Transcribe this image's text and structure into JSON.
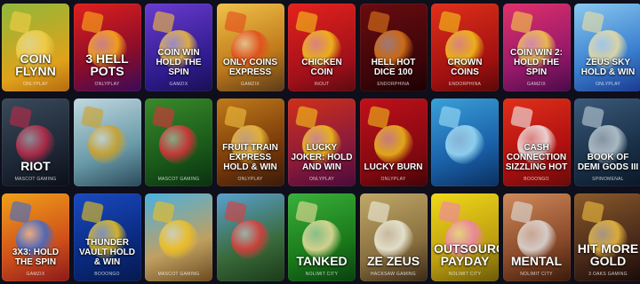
{
  "games": [
    {
      "title": "COIN FLYNN",
      "provider": "ONLYPLAY",
      "bg": "linear-gradient(160deg,#8fb83a,#e0a21a 70%,#b36a12)",
      "accent": "#f5d04a",
      "big": true
    },
    {
      "title": "3 HELL POTS",
      "provider": "ONLYPLAY",
      "bg": "linear-gradient(160deg,#e0201c,#8a0d2a 60%,#3a0a5a)",
      "accent": "#ffb31a",
      "big": true
    },
    {
      "title": "COIN WIN HOLD THE SPIN",
      "provider": "GAMZIX",
      "bg": "linear-gradient(160deg,#6a3bd0,#2d1a8a 70%,#1a1050)",
      "accent": "#f6c23a",
      "big": false
    },
    {
      "title": "ONLY COINS EXPRESS",
      "provider": "GAMZIX",
      "bg": "linear-gradient(160deg,#f0c24a,#c07a1a 60%,#5a3a1a)",
      "accent": "#e44a1a",
      "big": false
    },
    {
      "title": "CHICKEN COIN",
      "provider": "INOUT",
      "bg": "linear-gradient(160deg,#e5221c,#a0101a 70%,#5a0a10)",
      "accent": "#f5c81a",
      "big": false
    },
    {
      "title": "HELL HOT DICE 100",
      "provider": "ENDORPHINA",
      "bg": "linear-gradient(160deg,#6a0c10,#3a0508 70%,#1a0204)",
      "accent": "#e07a1a",
      "big": false
    },
    {
      "title": "CROWN COINS",
      "provider": "ENDORPHINA",
      "bg": "linear-gradient(160deg,#e0301a,#a01010 70%,#5a0808)",
      "accent": "#f6c81a",
      "big": false
    },
    {
      "title": "COIN WIN 2: HOLD THE SPIN",
      "provider": "GAMZIX",
      "bg": "linear-gradient(160deg,#e0306a,#9a1a6a 60%,#4a0a4a)",
      "accent": "#f5d04a",
      "big": false
    },
    {
      "title": "ZEUS SKY HOLD & WIN",
      "provider": "ONLYPLAY",
      "bg": "linear-gradient(160deg,#8ac8f0,#3a80d0 60%,#1a3a90)",
      "accent": "#f0e0a0",
      "big": false
    },
    {
      "title": "RIOT",
      "provider": "MASCOT GAMING",
      "bg": "linear-gradient(160deg,#3a4a5a,#1a2230 70%,#0a1018)",
      "accent": "#c02a4a",
      "big": true
    },
    {
      "title": "",
      "provider": "",
      "bg": "linear-gradient(160deg,#c0d8e0,#6a9aa8 60%,#2a4a5a)",
      "accent": "#d0a020",
      "big": false
    },
    {
      "title": "",
      "provider": "MASCOT GAMING",
      "bg": "linear-gradient(160deg,#3a8a2a,#1a5a1a 60%,#0a3010)",
      "accent": "#e0303a",
      "big": false
    },
    {
      "title": "FRUIT TRAIN EXPRESS HOLD & WIN",
      "provider": "ONLYPLAY",
      "bg": "linear-gradient(160deg,#c07a1a,#7a3a0a 60%,#3a1a0a)",
      "accent": "#f0c040",
      "big": false
    },
    {
      "title": "LUCKY JOKER: HOLD AND WIN",
      "provider": "ONLYPLAY",
      "bg": "linear-gradient(160deg,#d0301a,#8a1a3a 60%,#4a0a3a)",
      "accent": "#f5c81a",
      "big": false
    },
    {
      "title": "LUCKY BURN",
      "provider": "ONLYPLAY",
      "bg": "linear-gradient(160deg,#c0101a,#800810 70%,#400408)",
      "accent": "#f0c01a",
      "big": false
    },
    {
      "title": "",
      "provider": "",
      "bg": "linear-gradient(160deg,#3aa0d8,#1a60a8 60%,#0a3060)",
      "accent": "#a0e0f8",
      "big": false
    },
    {
      "title": "CASH CONNECTION SIZZLING HOT",
      "provider": "BOOONGO",
      "bg": "linear-gradient(160deg,#e0301a,#b01010 60%,#6a0a0a)",
      "accent": "#f0f0f0",
      "big": false
    },
    {
      "title": "BOOK OF DEMI GODS III",
      "provider": "SPINOMENAL",
      "bg": "linear-gradient(160deg,#3a5a7a,#1a3048 60%,#0a1828)",
      "accent": "#c0d0d8",
      "big": false
    },
    {
      "title": "3X3: HOLD THE SPIN",
      "provider": "GAMZIX",
      "bg": "linear-gradient(160deg,#f0a01a,#d0501a 60%,#8a1a1a)",
      "accent": "#3a6ad0",
      "big": false
    },
    {
      "title": "THUNDER VAULT HOLD & WIN",
      "provider": "BOOONGO",
      "bg": "linear-gradient(160deg,#1a4ac0,#0a2a80 60%,#061a50)",
      "accent": "#f0c81a",
      "big": false
    },
    {
      "title": "",
      "provider": "MASCOT GAMING",
      "bg": "linear-gradient(160deg,#4ab0e0,#c0a060 60%,#6a4a20)",
      "accent": "#f0c020",
      "big": false
    },
    {
      "title": "",
      "provider": "",
      "bg": "linear-gradient(160deg,#5aa0d0,#3a6a3a 60%,#1a3a1a)",
      "accent": "#e03a3a",
      "big": false
    },
    {
      "title": "TANKED",
      "provider": "NOLIMIT CITY",
      "bg": "linear-gradient(160deg,#3ab03a,#1a7a1a 60%,#0a4010)",
      "accent": "#f0e0a0",
      "big": true
    },
    {
      "title": "ZE ZEUS",
      "provider": "HACKSAW GAMING",
      "bg": "linear-gradient(160deg,#c0a868,#8a7040 60%,#3a2a18)",
      "accent": "#f0f0e0",
      "big": true
    },
    {
      "title": "OUTSOURCED PAYDAY",
      "provider": "NOLIMIT CITY",
      "bg": "linear-gradient(160deg,#f0d81a,#c0a010 60%,#6a5a08)",
      "accent": "#f080b0",
      "big": true
    },
    {
      "title": "MENTAL",
      "provider": "NOLIMIT CITY",
      "bg": "linear-gradient(160deg,#d08a5a,#8a4a2a 60%,#3a1a0a)",
      "accent": "#e0e0e0",
      "big": true
    },
    {
      "title": "HIT MORE GOLD",
      "provider": "3 OAKS GAMING",
      "bg": "linear-gradient(160deg,#8a5a2a,#4a2a1a 60%,#1a0a08)",
      "accent": "#f0c040",
      "big": true
    }
  ]
}
